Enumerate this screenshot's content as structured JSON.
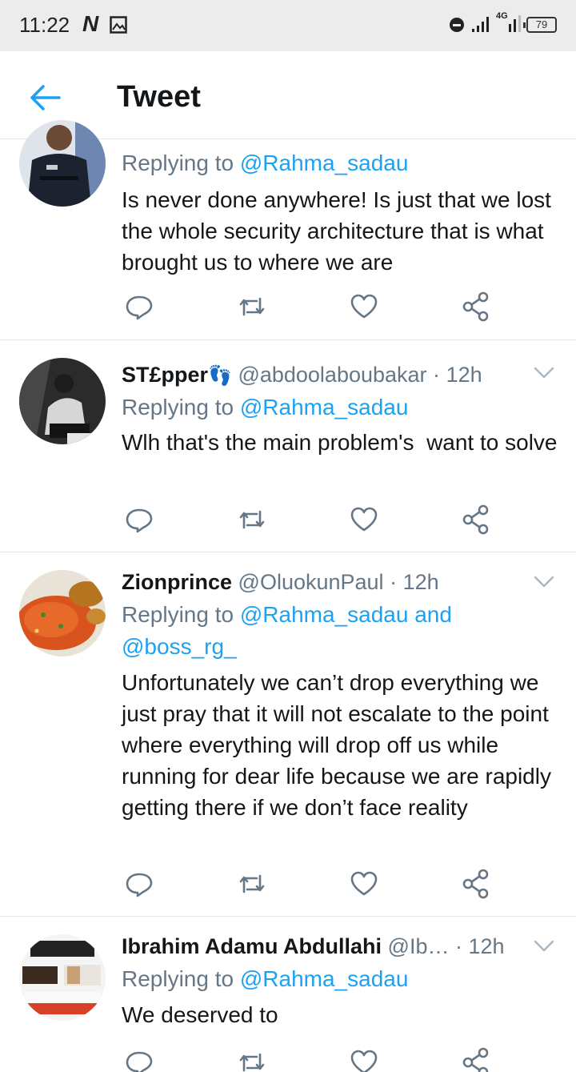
{
  "status_bar": {
    "time": "11:22",
    "app_glyph": "N",
    "network_label": "4G",
    "battery": "79"
  },
  "header": {
    "title": "Tweet",
    "accent_color": "#1da1f2"
  },
  "tweets": [
    {
      "name": "",
      "handle": "",
      "time": "",
      "replying_prefix": "Replying to ",
      "replying_to": "@Rahma_sadau",
      "replying_to_2": "",
      "text": "Is never done anywhere! Is just that we lost the whole security architecture that is what brought us to where we are"
    },
    {
      "name": "ST£pper",
      "emoji": "👣",
      "handle": "@abdoolaboubakar",
      "dot": "·",
      "time": "12h",
      "replying_prefix": "Replying to ",
      "replying_to": "@Rahma_sadau",
      "text": "Wlh that's the main problem's  want to solve"
    },
    {
      "name": "Zionprince",
      "handle": "@OluokunPaul",
      "dot": "·",
      "time": "12h",
      "replying_prefix": "Replying to ",
      "replying_to": "@Rahma_sadau and",
      "replying_to_2": "@boss_rg_",
      "text": "Unfortunately we can’t drop everything we just pray that it will not escalate to the point where everything will drop off us while running for dear life because we are rapidly getting there if we don’t face reality"
    },
    {
      "name": "Ibrahim Adamu Abdullahi",
      "handle": "@Ib…",
      "dot": "·",
      "time": "12h",
      "replying_prefix": "Replying to ",
      "replying_to": "@Rahma_sadau",
      "text": "We deserved to"
    }
  ],
  "icons": {
    "reply": "reply-icon",
    "retweet": "retweet-icon",
    "like": "heart-icon",
    "share": "share-icon",
    "more": "chevron-down-icon",
    "back": "back-arrow-icon"
  }
}
